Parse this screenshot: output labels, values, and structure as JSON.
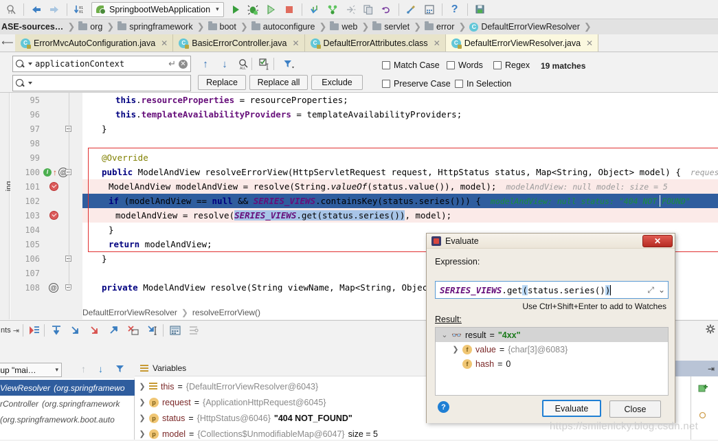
{
  "toolbar": {
    "icons": [
      "search-everywhere-icon",
      "back-icon",
      "forward-icon",
      "step-over-icon"
    ],
    "run_config": "SpringbootWebApplication",
    "run_label": "run-icon",
    "buttons": [
      "run",
      "debug",
      "run-with-coverage",
      "stop",
      "step-into",
      "step-out",
      "run-to-cursor",
      "copy",
      "undo",
      "settings",
      "structure",
      "help",
      "save-all"
    ]
  },
  "breadcrumb": {
    "items": [
      {
        "label": "ASE-sources…",
        "icon": "none"
      },
      {
        "label": "org",
        "icon": "folder"
      },
      {
        "label": "springframework",
        "icon": "folder"
      },
      {
        "label": "boot",
        "icon": "folder"
      },
      {
        "label": "autoconfigure",
        "icon": "folder"
      },
      {
        "label": "web",
        "icon": "folder"
      },
      {
        "label": "servlet",
        "icon": "folder"
      },
      {
        "label": "error",
        "icon": "folder"
      },
      {
        "label": "DefaultErrorViewResolver",
        "icon": "class"
      }
    ]
  },
  "tabs": [
    {
      "label": "ErrorMvcAutoConfiguration.java",
      "active": false
    },
    {
      "label": "BasicErrorController.java",
      "active": false
    },
    {
      "label": "DefaultErrorAttributes.class",
      "active": false
    },
    {
      "label": "DefaultErrorViewResolver.java",
      "active": true
    }
  ],
  "find": {
    "search_value": "applicationContext",
    "replace_value": "",
    "replace_label": "Replace",
    "replace_all_label": "Replace all",
    "exclude_label": "Exclude",
    "match_case_label": "Match Case",
    "words_label": "Words",
    "regex_label": "Regex",
    "preserve_case_label": "Preserve Case",
    "in_selection_label": "In Selection",
    "matches": "19 matches",
    "match_case_checked": false,
    "words_checked": false,
    "regex_checked": false,
    "preserve_case_checked": false,
    "in_selection_checked": false
  },
  "editor": {
    "left_strip_label": "ing",
    "lines": [
      {
        "num": "95",
        "indent": 4,
        "html": "<span class=\"kw\">this</span>.<span class=\"fld\">resourceProperties</span> = resourceProperties;"
      },
      {
        "num": "96",
        "indent": 4,
        "html": "<span class=\"kw\">this</span>.<span class=\"fld\">templateAvailabilityProviders</span> = templateAvailabilityProviders;"
      },
      {
        "num": "97",
        "indent": 2,
        "html": "}"
      },
      {
        "num": "98",
        "indent": 0,
        "html": ""
      },
      {
        "num": "99",
        "indent": 2,
        "html": "<span class=\"ann\">@Override</span>"
      },
      {
        "num": "100",
        "indent": 2,
        "html": "<span class=\"kw\">public</span> ModelAndView resolveErrorView(HttpServletRequest request, HttpStatus status, Map&lt;String, Object&gt; model) {"
      },
      {
        "num": "101",
        "indent": 3,
        "html": "ModelAndView modelAndView = resolve(String.<span class=\"mtd-i\">valueOf</span>(status.value()), model);"
      },
      {
        "num": "102",
        "indent": 3,
        "html": "<span class=\"kw\">if</span> (modelAndView == <span class=\"kw\">null</span> &amp;&amp; <span class=\"stat\">SERIES_VIEWS</span>.containsKey(status.series())) {"
      },
      {
        "num": "103",
        "indent": 4,
        "html": "modelAndView = resolve(<span class=\"searchhl\"><span class=\"stat\">SERIES_VIEWS</span>.get(status.series())</span>, model);"
      },
      {
        "num": "104",
        "indent": 3,
        "html": "}"
      },
      {
        "num": "105",
        "indent": 3,
        "html": "<span class=\"kw\">return</span> modelAndView;"
      },
      {
        "num": "106",
        "indent": 2,
        "html": "}"
      },
      {
        "num": "107",
        "indent": 0,
        "html": ""
      },
      {
        "num": "108",
        "indent": 2,
        "html": "<span class=\"kw\">private</span> ModelAndView resolve(String viewName, Map&lt;String, Object&gt; mo"
      }
    ],
    "inline_hints": [
      {
        "line": "100",
        "text": "request:  Applic…",
        "style": "grey"
      },
      {
        "line": "101",
        "text": "modelAndView:  null    model:   size = 5",
        "style": "grey"
      },
      {
        "line": "102",
        "text": "modelAndView:  null    status:  \"404 NOT_FOUND\"",
        "style": "green"
      }
    ],
    "breadcrumb_footer": [
      "DefaultErrorViewResolver",
      "resolveErrorView()"
    ]
  },
  "debug_toolbar": {
    "label": "nts",
    "icons": [
      "resume-icon",
      "step-over-icon",
      "step-into-icon",
      "force-step-into-icon",
      "step-out-icon",
      "drop-frame-icon",
      "run-to-cursor-icon",
      "evaluate-icon",
      "settings-icon"
    ]
  },
  "frames": {
    "thread_combo": "group \"mai…",
    "rows": [
      {
        "label": "ViewResolver",
        "pkg": "(org.springframewo",
        "selected": true
      },
      {
        "label": "rController",
        "pkg": "(org.springframework",
        "selected": false
      },
      {
        "label": "",
        "pkg": "(org.springframework.boot.auto",
        "selected": false
      }
    ]
  },
  "variables": {
    "title": "Variables",
    "rows": [
      {
        "name": "this",
        "value": "{DefaultErrorViewResolver@6043}",
        "extra": "",
        "icon": "this-icon"
      },
      {
        "name": "request",
        "value": "{ApplicationHttpRequest@6045}",
        "extra": "",
        "icon": "parameter-icon"
      },
      {
        "name": "status",
        "value": "{HttpStatus@6046}",
        "extra": "\"404 NOT_FOUND\"",
        "icon": "parameter-icon"
      },
      {
        "name": "model",
        "value": "{Collections$UnmodifiableMap@6047}",
        "extra": "size = 5",
        "icon": "parameter-icon"
      }
    ]
  },
  "evaluate_dialog": {
    "title": "Evaluate",
    "expression_label": "Expression:",
    "expression_static": "SERIES_VIEWS",
    "expression_rest": ".get",
    "expression_paren_open": "(",
    "expression_arg": "status.series()",
    "expression_paren_close": ")",
    "hint": "Use Ctrl+Shift+Enter to add to Watches",
    "result_label": "Result:",
    "result_rows": [
      {
        "indent": 0,
        "twisty": "v",
        "icon": "result-icon",
        "name": "result",
        "eq": "=",
        "value": "\"4xx\"",
        "value_style": "string",
        "selected": true
      },
      {
        "indent": 1,
        "twisty": ">",
        "icon": "field-icon",
        "name": "value",
        "eq": "=",
        "value": "{char[3]@6083}",
        "value_style": "ref",
        "selected": false
      },
      {
        "indent": 1,
        "twisty": "",
        "icon": "field-icon",
        "name": "hash",
        "eq": "=",
        "value": "0",
        "value_style": "plain",
        "selected": false
      }
    ],
    "evaluate_button": "Evaluate",
    "close_button": "Close",
    "help_button": "?"
  },
  "watermark": "https://smilenicky.blog.csdn.net",
  "colors": {
    "accent_blue": "#2f5d9e",
    "selection_blue": "#2f5d9e",
    "tab_active": "#fbf8df",
    "breakpoint_red": "#db5c5c",
    "dialog_bg": "#f0ece4"
  }
}
